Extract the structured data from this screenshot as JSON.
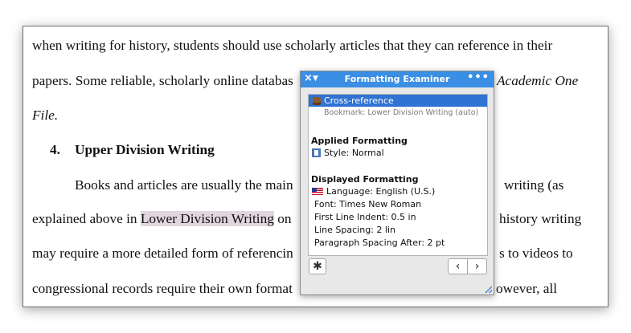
{
  "document": {
    "line1": "when writing for history, students should use scholarly articles that they can reference in their",
    "line2": "papers. Some reliable, scholarly online databas",
    "line2_right": "Academic One",
    "line3": "File.",
    "heading_num": "4.",
    "heading_text": "Upper Division Writing",
    "line5_left": "Books and articles are usually the main",
    "line5_right": "writing (as",
    "line6_left": "explained above in ",
    "line6_link": "Lower Division Writing",
    "line6_after": " on",
    "line6_right": "history writing",
    "line7_left": "may require a more detailed form of referencin",
    "line7_right": "s to videos to",
    "line8_left": "congressional records require their own format",
    "line8_right": "owever, all"
  },
  "examiner": {
    "title": "Formatting Examiner",
    "close_icon": "×",
    "collapse_icon": "▼",
    "more_icon": "•••",
    "selected_item": "Cross-reference",
    "bookmark": "Bookmark: Lower Division Writing (auto)",
    "applied_heading": "Applied Formatting",
    "style": "Style: Normal",
    "displayed_heading": "Displayed Formatting",
    "language": "Language: English (U.S.)",
    "font": "Font: Times New Roman",
    "indent": "First Line Indent: 0.5 in",
    "spacing": "Line Spacing: 2 lin",
    "para_spacing": "Paragraph Spacing After: 2 pt",
    "gear_icon": "✱",
    "prev_icon": "‹",
    "next_icon": "›"
  },
  "colors": {
    "title_bar": "#3a8fe4",
    "selection": "#2f73d3",
    "highlight": "#e2d6de"
  }
}
